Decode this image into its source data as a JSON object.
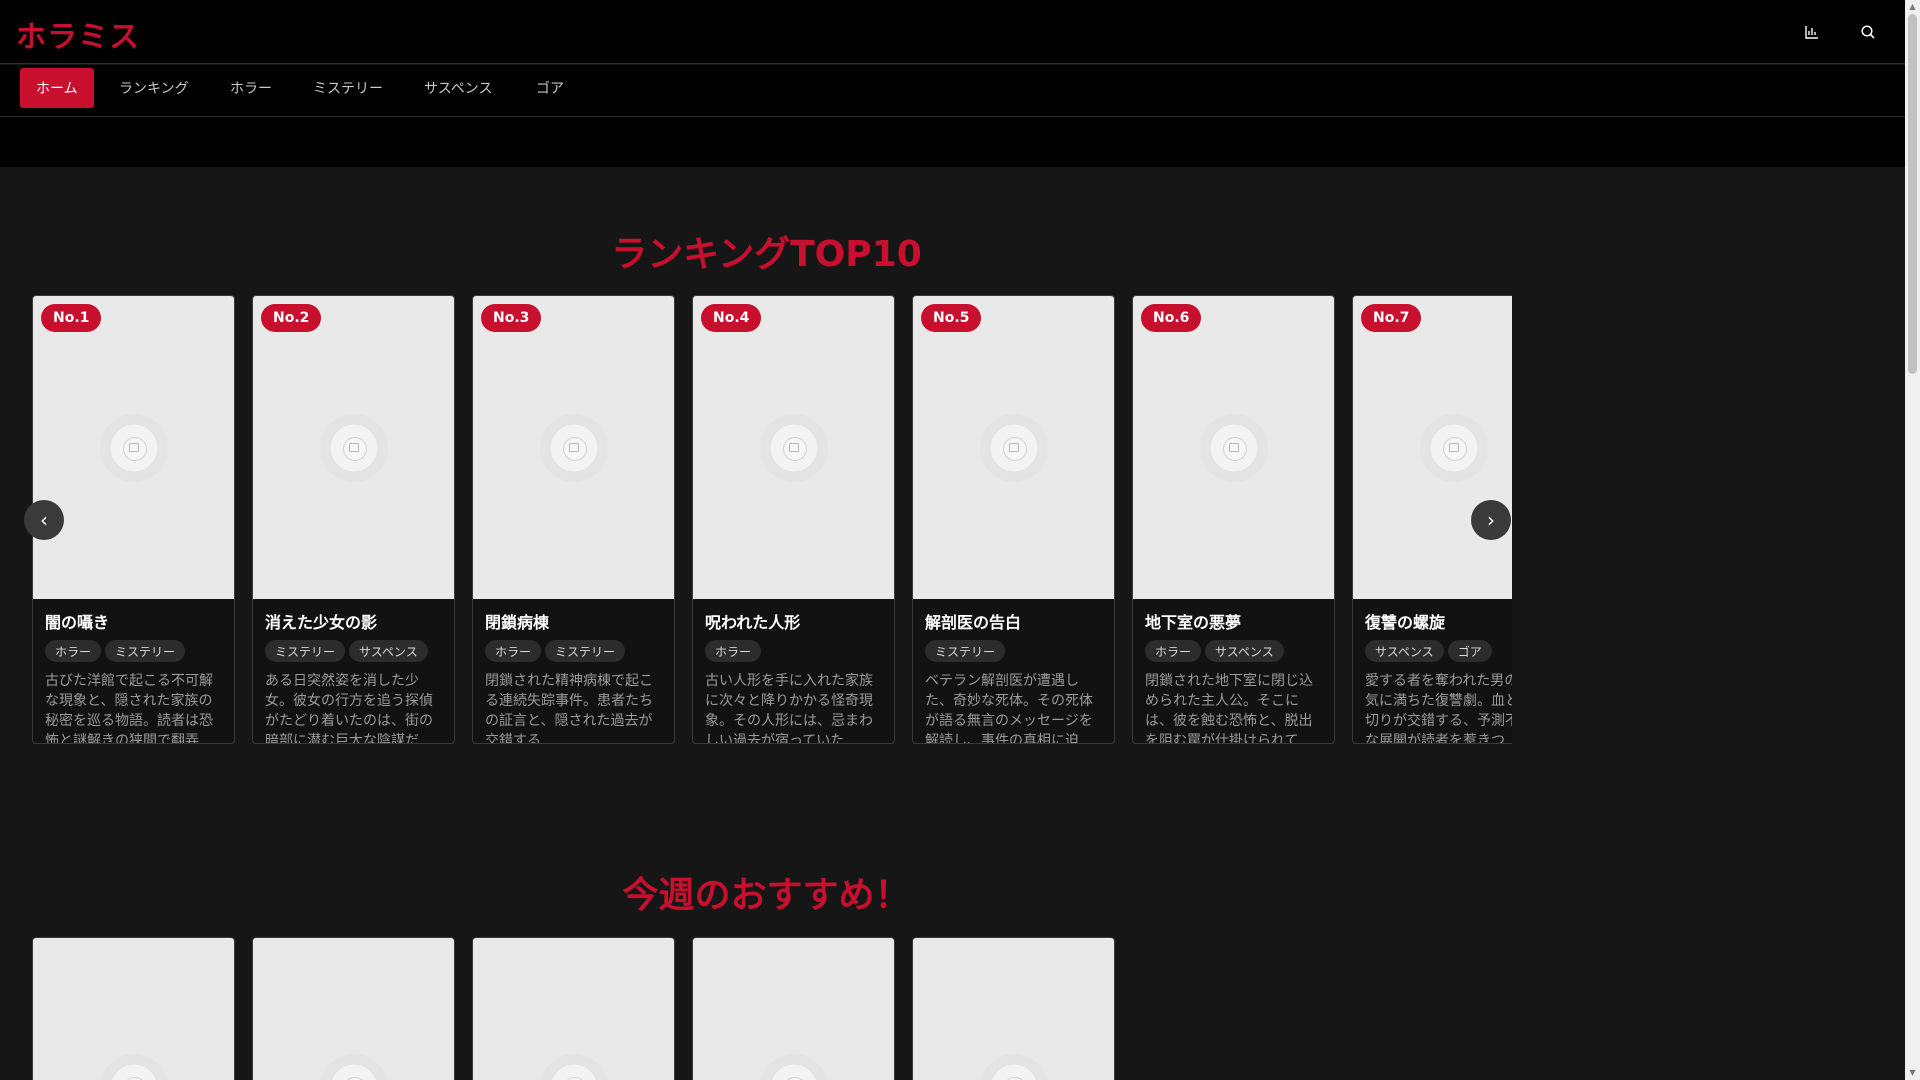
{
  "header": {
    "logo": "ホラミス",
    "icons": [
      "bar-chart-icon",
      "search-icon"
    ]
  },
  "nav": {
    "items": [
      {
        "label": "ホーム",
        "active": true
      },
      {
        "label": "ランキング",
        "active": false
      },
      {
        "label": "ホラー",
        "active": false
      },
      {
        "label": "ミステリー",
        "active": false
      },
      {
        "label": "サスペンス",
        "active": false
      },
      {
        "label": "ゴア",
        "active": false
      }
    ]
  },
  "ranking": {
    "title": "ランキングTOP10",
    "cards": [
      {
        "rank": "No.1",
        "title": "闇の囁き",
        "tags": [
          "ホラー",
          "ミステリー"
        ],
        "desc": "古びた洋館で起こる不可解な現象と、隠された家族の秘密を巡る物語。読者は恐怖と謎解きの狭間で翻弄さ…"
      },
      {
        "rank": "No.2",
        "title": "消えた少女の影",
        "tags": [
          "ミステリー",
          "サスペンス"
        ],
        "desc": "ある日突然姿を消した少女。彼女の行方を追う探偵がたどり着いたのは、街の暗部に潜む巨大な陰謀だっ…"
      },
      {
        "rank": "No.3",
        "title": "閉鎖病棟",
        "tags": [
          "ホラー",
          "ミステリー"
        ],
        "desc": "閉鎖された精神病棟で起こる連続失踪事件。患者たちの証言と、隠された過去が交錯する…"
      },
      {
        "rank": "No.4",
        "title": "呪われた人形",
        "tags": [
          "ホラー"
        ],
        "desc": "古い人形を手に入れた家族に次々と降りかかる怪奇現象。その人形には、忌まわしい過去が宿っていた…"
      },
      {
        "rank": "No.5",
        "title": "解剖医の告白",
        "tags": [
          "ミステリー"
        ],
        "desc": "ベテラン解剖医が遭遇した、奇妙な死体。その死体が語る無言のメッセージを解読し、事件の真相に迫…"
      },
      {
        "rank": "No.6",
        "title": "地下室の悪夢",
        "tags": [
          "ホラー",
          "サスペンス"
        ],
        "desc": "閉鎖された地下室に閉じ込められた主人公。そこには、彼を蝕む恐怖と、脱出を阻む罠が仕掛けられてい…"
      },
      {
        "rank": "No.7",
        "title": "復讐の螺旋",
        "tags": [
          "サスペンス",
          "ゴア"
        ],
        "desc": "愛する者を奪われた男の狂気に満ちた復讐劇。血と裏切りが交錯する、予測不能な展開が読者を惹きつ…"
      }
    ]
  },
  "recommend": {
    "title": "今週のおすすめ！",
    "card_count": 5
  },
  "colors": {
    "accent": "#c8102e",
    "background": "#161616",
    "header": "#000000"
  }
}
